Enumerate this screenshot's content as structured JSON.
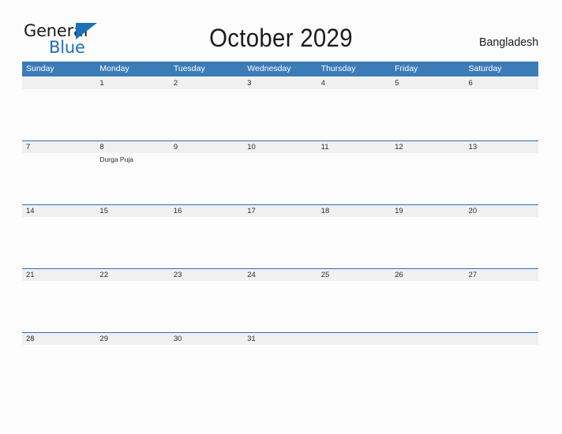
{
  "brand": {
    "name_part1": "General",
    "name_part2": "Blue",
    "flag_icon": "blue-triangle-flag-icon",
    "accent_color": "#1b72b8"
  },
  "header": {
    "title": "October 2029",
    "country": "Bangladesh"
  },
  "colors": {
    "header_blue": "#3b7cb8",
    "rule_blue": "#2a72b5",
    "date_band_gray": "#f0f0f0",
    "page_background": "#fcfcfd",
    "text": "#2b2b2b"
  },
  "calendar": {
    "day_headers": [
      "Sunday",
      "Monday",
      "Tuesday",
      "Wednesday",
      "Thursday",
      "Friday",
      "Saturday"
    ],
    "weeks": [
      {
        "days": [
          {
            "date": "",
            "events": []
          },
          {
            "date": "1",
            "events": []
          },
          {
            "date": "2",
            "events": []
          },
          {
            "date": "3",
            "events": []
          },
          {
            "date": "4",
            "events": []
          },
          {
            "date": "5",
            "events": []
          },
          {
            "date": "6",
            "events": []
          }
        ]
      },
      {
        "days": [
          {
            "date": "7",
            "events": []
          },
          {
            "date": "8",
            "events": [
              "Durga Puja"
            ]
          },
          {
            "date": "9",
            "events": []
          },
          {
            "date": "10",
            "events": []
          },
          {
            "date": "11",
            "events": []
          },
          {
            "date": "12",
            "events": []
          },
          {
            "date": "13",
            "events": []
          }
        ]
      },
      {
        "days": [
          {
            "date": "14",
            "events": []
          },
          {
            "date": "15",
            "events": []
          },
          {
            "date": "16",
            "events": []
          },
          {
            "date": "17",
            "events": []
          },
          {
            "date": "18",
            "events": []
          },
          {
            "date": "19",
            "events": []
          },
          {
            "date": "20",
            "events": []
          }
        ]
      },
      {
        "days": [
          {
            "date": "21",
            "events": []
          },
          {
            "date": "22",
            "events": []
          },
          {
            "date": "23",
            "events": []
          },
          {
            "date": "24",
            "events": []
          },
          {
            "date": "25",
            "events": []
          },
          {
            "date": "26",
            "events": []
          },
          {
            "date": "27",
            "events": []
          }
        ]
      },
      {
        "days": [
          {
            "date": "28",
            "events": []
          },
          {
            "date": "29",
            "events": []
          },
          {
            "date": "30",
            "events": []
          },
          {
            "date": "31",
            "events": []
          },
          {
            "date": "",
            "events": []
          },
          {
            "date": "",
            "events": []
          },
          {
            "date": "",
            "events": []
          }
        ]
      }
    ]
  }
}
